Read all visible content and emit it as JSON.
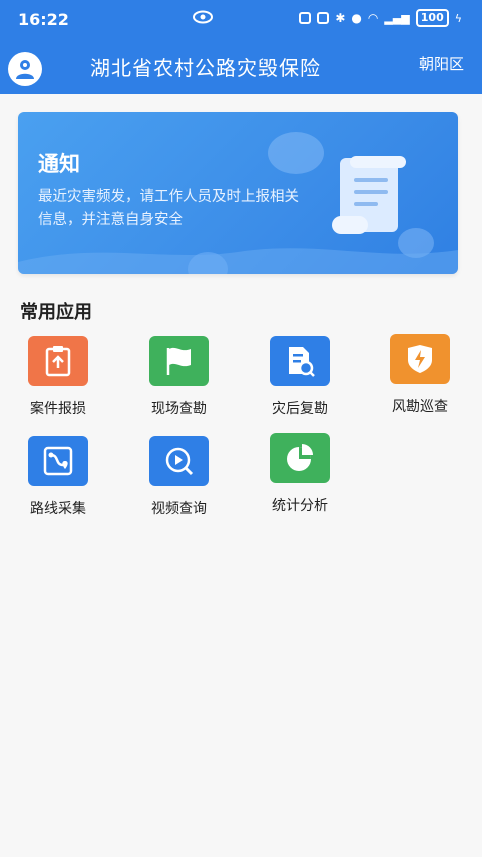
{
  "status_bar": {
    "time": "16:22",
    "battery": "100"
  },
  "header": {
    "title": "湖北省农村公路灾毁保险",
    "region": "朝阳区"
  },
  "notice": {
    "title": "通知",
    "text": "最近灾害频发，请工作人员及时上报相关信息，并注意自身安全"
  },
  "apps_section": {
    "title": "常用应用",
    "apps": [
      {
        "label": "案件报损",
        "icon": "clipboard-upload-icon",
        "color": "#f07548"
      },
      {
        "label": "现场查勘",
        "icon": "flag-icon",
        "color": "#3fb15c"
      },
      {
        "label": "灾后复勘",
        "icon": "document-search-icon",
        "color": "#2f7fe6"
      },
      {
        "label": "风勘巡查",
        "icon": "lightning-shield-icon",
        "color": "#f0922e"
      },
      {
        "label": "路线采集",
        "icon": "route-pin-icon",
        "color": "#2f7fe6"
      },
      {
        "label": "视频查询",
        "icon": "video-search-icon",
        "color": "#2f7fe6"
      },
      {
        "label": "统计分析",
        "icon": "pie-chart-icon",
        "color": "#3fb15c"
      }
    ]
  }
}
